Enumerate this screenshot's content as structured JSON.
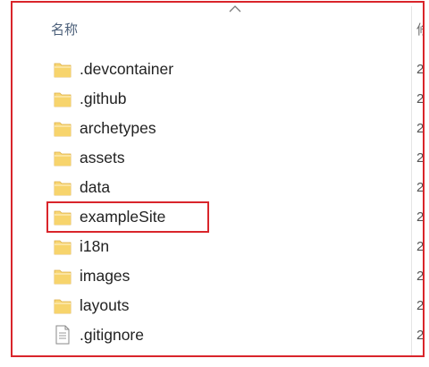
{
  "header": {
    "name_label": "名称",
    "date_label_partial": "修"
  },
  "files": [
    {
      "name": ".devcontainer",
      "type": "folder",
      "date_partial": "2"
    },
    {
      "name": ".github",
      "type": "folder",
      "date_partial": "2"
    },
    {
      "name": "archetypes",
      "type": "folder",
      "date_partial": "2"
    },
    {
      "name": "assets",
      "type": "folder",
      "date_partial": "2"
    },
    {
      "name": "data",
      "type": "folder",
      "date_partial": "2"
    },
    {
      "name": "exampleSite",
      "type": "folder",
      "date_partial": "2",
      "highlighted": true
    },
    {
      "name": "i18n",
      "type": "folder",
      "date_partial": "2"
    },
    {
      "name": "images",
      "type": "folder",
      "date_partial": "2"
    },
    {
      "name": "layouts",
      "type": "folder",
      "date_partial": "2"
    },
    {
      "name": ".gitignore",
      "type": "file",
      "date_partial": "2"
    }
  ],
  "colors": {
    "annotation_border": "#d9252b",
    "folder_fill": "#f8d775",
    "folder_tab": "#e8b94a"
  },
  "icons": {
    "folder": "folder-icon",
    "file": "text-file-icon",
    "sort": "sort-ascending-icon"
  }
}
